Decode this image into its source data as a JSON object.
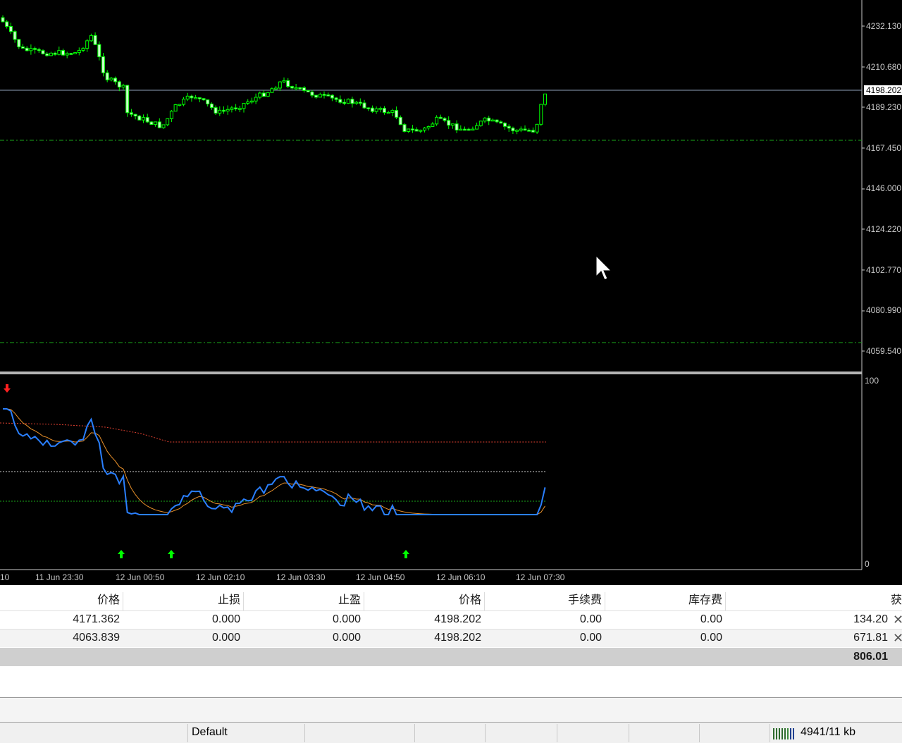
{
  "chart": {
    "price_scale": [
      "4232.130",
      "4210.680",
      "4189.230",
      "4167.450",
      "4146.000",
      "4124.220",
      "4102.770",
      "4080.990",
      "4059.540"
    ],
    "current_price": "4198.202",
    "indicator_scale": {
      "top": "100",
      "bottom": "0"
    },
    "time_axis": [
      "10",
      "11 Jun 23:30",
      "12 Jun 00:50",
      "12 Jun 02:10",
      "12 Jun 03:30",
      "12 Jun 04:50",
      "12 Jun 06:10",
      "12 Jun 07:30"
    ],
    "colors": {
      "background": "#000000",
      "bull_candle": "#00ff00",
      "bear_candle": "#ffffff",
      "k_line": "#2a7fff",
      "d_line": "#e8902a",
      "up_arrow": "#00ff00",
      "down_arrow": "#ff2020"
    },
    "signals": {
      "up_arrow_icon": "up-arrow-icon",
      "down_arrow_icon": "down-arrow-icon"
    }
  },
  "terminal": {
    "headers": [
      "价格",
      "止损",
      "止盈",
      "价格",
      "手续费",
      "库存费",
      "获利"
    ],
    "rows": [
      [
        "4171.362",
        "0.000",
        "0.000",
        "4198.202",
        "0.00",
        "0.00",
        "134.20"
      ],
      [
        "4063.839",
        "0.000",
        "0.000",
        "4198.202",
        "0.00",
        "0.00",
        "671.81"
      ]
    ],
    "total": "806.01"
  },
  "status_bar": {
    "profile": "Default",
    "traffic": "4941/11 kb"
  }
}
